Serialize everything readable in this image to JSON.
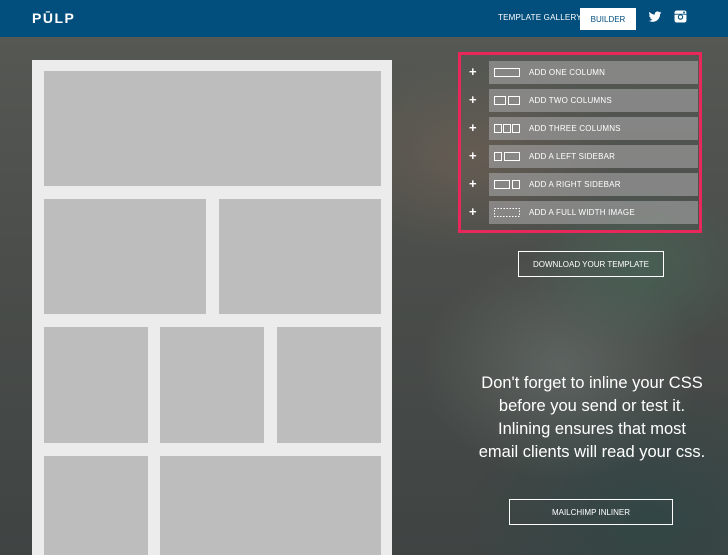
{
  "header": {
    "logo": "PŪLP",
    "nav_gallery": "TEMPLATE GALLERY",
    "nav_builder": "BUILDER",
    "social": [
      "twitter-icon",
      "instagram-icon"
    ],
    "brand_color": "#024e7c"
  },
  "options": {
    "highlight_color": "#e8285a",
    "items": [
      {
        "label": "ADD ONE COLUMN",
        "icon": "one-column-icon"
      },
      {
        "label": "ADD TWO COLUMNS",
        "icon": "two-columns-icon"
      },
      {
        "label": "ADD THREE COLUMNS",
        "icon": "three-columns-icon"
      },
      {
        "label": "ADD A LEFT SIDEBAR",
        "icon": "left-sidebar-icon"
      },
      {
        "label": "ADD A RIGHT SIDEBAR",
        "icon": "right-sidebar-icon"
      },
      {
        "label": "ADD A FULL WIDTH IMAGE",
        "icon": "full-width-image-icon"
      }
    ],
    "plus_symbol": "+"
  },
  "download_button": "DOWNLOAD YOUR TEMPLATE",
  "notice": "Don't forget to inline your CSS before you send or test it. Inlining ensures that most email clients will read your css.",
  "mailchimp_button": "MAILCHIMP INLINER"
}
